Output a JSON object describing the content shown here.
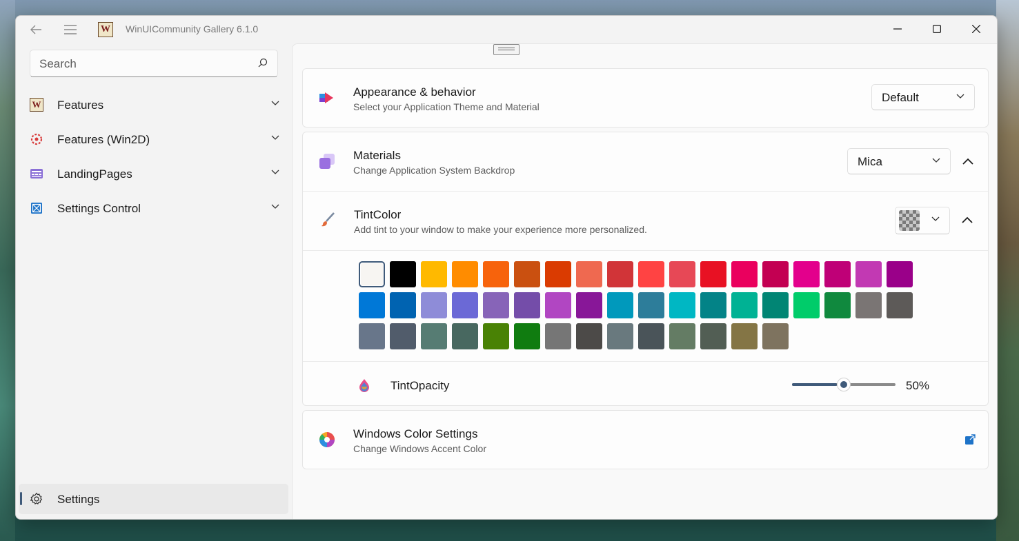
{
  "app": {
    "title": "WinUICommunity Gallery 6.1.0",
    "logo_letter": "W"
  },
  "titlebar": {
    "back_icon": "back-arrow-icon",
    "menu_icon": "hamburger-icon",
    "minimize_icon": "minimize-icon",
    "maximize_icon": "maximize-icon",
    "close_icon": "close-icon"
  },
  "sidebar": {
    "search": {
      "placeholder": "Search",
      "icon": "search-icon"
    },
    "items": [
      {
        "label": "Features",
        "icon": "winui-logo-icon"
      },
      {
        "label": "Features (Win2D)",
        "icon": "win2d-icon"
      },
      {
        "label": "LandingPages",
        "icon": "landing-pages-icon"
      },
      {
        "label": "Settings Control",
        "icon": "settings-control-icon"
      }
    ],
    "footer": {
      "label": "Settings",
      "icon": "gear-icon"
    }
  },
  "settings": {
    "appearance": {
      "title": "Appearance & behavior",
      "subtitle": "Select your Application Theme and Material",
      "value": "Default"
    },
    "materials": {
      "title": "Materials",
      "subtitle": "Change Application System Backdrop",
      "value": "Mica"
    },
    "tint": {
      "title": "TintColor",
      "subtitle": "Add tint to your window to make your experience more personalized.",
      "selected_index": 0,
      "colors": [
        "#f7f5f2",
        "#000000",
        "#ffb900",
        "#ff8c00",
        "#f7630c",
        "#ca5010",
        "#da3b01",
        "#ef6950",
        "#d13438",
        "#ff4343",
        "#e74856",
        "#e81123",
        "#ea005e",
        "#c30052",
        "#e3008c",
        "#bf0077",
        "#c239b3",
        "#9a0089",
        "#0078d7",
        "#0063b1",
        "#8e8cd8",
        "#6b69d6",
        "#8764b8",
        "#744da9",
        "#b146c2",
        "#881798",
        "#0099bc",
        "#2d7d9a",
        "#00b7c3",
        "#038387",
        "#00b294",
        "#018574",
        "#00cc6a",
        "#10893e",
        "#7a7574",
        "#5d5a58",
        "#68768a",
        "#515c6b",
        "#567c73",
        "#486860",
        "#498205",
        "#107c10",
        "#767676",
        "#4c4a48",
        "#69797e",
        "#4a5459",
        "#647c64",
        "#525e54",
        "#847545",
        "#7e735f"
      ]
    },
    "opacity": {
      "label": "TintOpacity",
      "value": 50,
      "value_text": "50%"
    },
    "windows_color": {
      "title": "Windows Color Settings",
      "subtitle": "Change Windows Accent Color",
      "action_icon": "external-link-icon"
    }
  },
  "colors": {
    "accent": "#3f5a7a",
    "window_bg": "#f3f3f3",
    "card_bg": "#fdfdfd"
  }
}
